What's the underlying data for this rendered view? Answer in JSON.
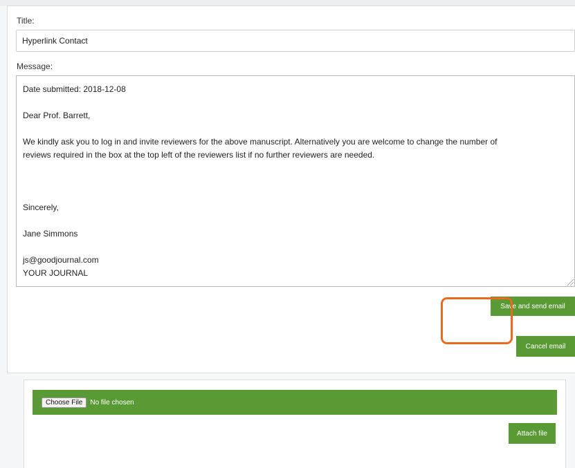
{
  "form": {
    "title_label": "Title:",
    "title_value": "Hyperlink Contact",
    "message_label": "Message:",
    "message": {
      "date_line": "Date submitted: 2018-12-08",
      "greeting": "Dear Prof. Barrett,",
      "body_line1": "We kindly ask you to log in and invite reviewers for the above manuscript. Alternatively you are welcome to change the number of",
      "body_line2": "reviews required in the box at the top left of the reviewers list if no further reviewers are needed.",
      "closing": "Sincerely,",
      "sender_name": "Jane Simmons",
      "sender_email": "js@goodjournal.com",
      "journal": "YOUR JOURNAL"
    }
  },
  "buttons": {
    "send_label": "Save and send email",
    "cancel_label": "Cancel email",
    "attach_label": "Attach file"
  },
  "attachments": {
    "choose_file_label": "Choose File",
    "no_file_text": "No file chosen"
  },
  "colors": {
    "accent_green": "#5a9a35",
    "highlight_orange": "#ea6a1e"
  }
}
